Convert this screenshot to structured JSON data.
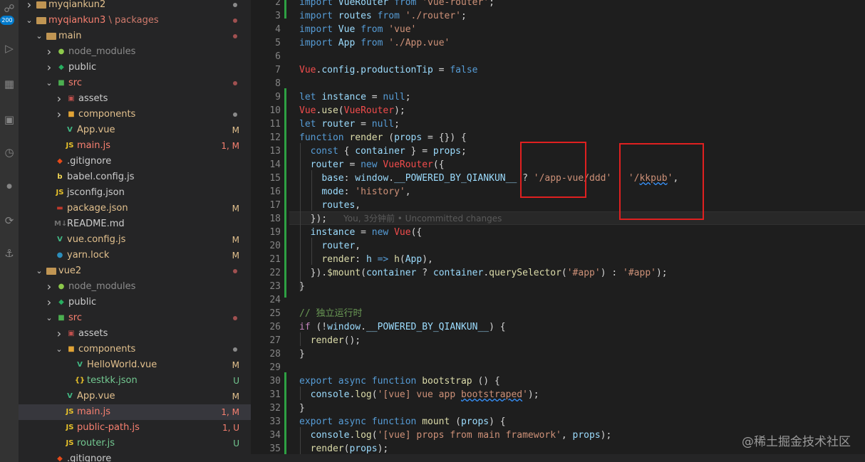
{
  "activity_bar": {
    "badge": "200",
    "icons": [
      "source-control-icon",
      "run-debug-icon",
      "extensions-icon",
      "remote-explorer-icon",
      "timeline-icon",
      "json-icon",
      "live-share-icon",
      "docker-icon"
    ]
  },
  "colors": {
    "keyword": "#569cd6",
    "control": "#c586c0",
    "string": "#ce9178",
    "variable": "#9cdcfe",
    "function": "#dcdcaa",
    "class": "#4ec9b0",
    "plain": "#d4d4d4",
    "comment": "#6a9955",
    "error_red": "#f14c4c",
    "modified": "#e2c08d",
    "untracked": "#73c991",
    "conflict": "#e2c08d"
  },
  "explorer": {
    "rows": [
      {
        "depth": 0,
        "type": "folder",
        "open": false,
        "name": "myqiankun2",
        "color": "#e2c08d",
        "status": "",
        "dot": "#8a8a8a"
      },
      {
        "depth": 0,
        "type": "folder",
        "open": true,
        "name": "myqiankun3",
        "suffix": "packages",
        "color": "#f88070",
        "status": "",
        "dot": "#a05050"
      },
      {
        "depth": 1,
        "type": "folder",
        "open": true,
        "name": "main",
        "color": "#e2c08d",
        "status": "",
        "dot": "#a05050"
      },
      {
        "depth": 2,
        "type": "folder",
        "open": false,
        "name": "node_modules",
        "icon": "node",
        "color": "#8c8c8c",
        "status": ""
      },
      {
        "depth": 2,
        "type": "folder",
        "open": false,
        "name": "public",
        "icon": "public",
        "color": "#cccccc",
        "status": ""
      },
      {
        "depth": 2,
        "type": "folder",
        "open": true,
        "name": "src",
        "icon": "src",
        "color": "#f88070",
        "status": "",
        "dot": "#a05050"
      },
      {
        "depth": 3,
        "type": "folder",
        "open": false,
        "name": "assets",
        "icon": "assets",
        "color": "#cccccc",
        "status": ""
      },
      {
        "depth": 3,
        "type": "folder",
        "open": false,
        "name": "components",
        "icon": "components",
        "color": "#e2c08d",
        "status": "",
        "dot": "#8a8a8a"
      },
      {
        "depth": 3,
        "type": "file",
        "name": "App.vue",
        "icon": "vue",
        "color": "#e2c08d",
        "status": "M"
      },
      {
        "depth": 3,
        "type": "file",
        "name": "main.js",
        "icon": "js",
        "color": "#f88070",
        "status": "1, M"
      },
      {
        "depth": 2,
        "type": "file",
        "name": ".gitignore",
        "icon": "git",
        "color": "#cccccc",
        "status": ""
      },
      {
        "depth": 2,
        "type": "file",
        "name": "babel.config.js",
        "icon": "babel",
        "color": "#cccccc",
        "status": ""
      },
      {
        "depth": 2,
        "type": "file",
        "name": "jsconfig.json",
        "icon": "js",
        "color": "#cccccc",
        "status": ""
      },
      {
        "depth": 2,
        "type": "file",
        "name": "package.json",
        "icon": "npm",
        "color": "#e2c08d",
        "status": "M"
      },
      {
        "depth": 2,
        "type": "file",
        "name": "README.md",
        "icon": "md",
        "color": "#cccccc",
        "status": ""
      },
      {
        "depth": 2,
        "type": "file",
        "name": "vue.config.js",
        "icon": "vue",
        "color": "#e2c08d",
        "status": "M"
      },
      {
        "depth": 2,
        "type": "file",
        "name": "yarn.lock",
        "icon": "yarn",
        "color": "#e2c08d",
        "status": "M"
      },
      {
        "depth": 1,
        "type": "folder",
        "open": true,
        "name": "vue2",
        "color": "#e2c08d",
        "status": "",
        "dot": "#a05050"
      },
      {
        "depth": 2,
        "type": "folder",
        "open": false,
        "name": "node_modules",
        "icon": "node",
        "color": "#8c8c8c",
        "status": ""
      },
      {
        "depth": 2,
        "type": "folder",
        "open": false,
        "name": "public",
        "icon": "public",
        "color": "#cccccc",
        "status": ""
      },
      {
        "depth": 2,
        "type": "folder",
        "open": true,
        "name": "src",
        "icon": "src",
        "color": "#f88070",
        "status": "",
        "dot": "#a05050"
      },
      {
        "depth": 3,
        "type": "folder",
        "open": false,
        "name": "assets",
        "icon": "assets",
        "color": "#cccccc",
        "status": ""
      },
      {
        "depth": 3,
        "type": "folder",
        "open": true,
        "name": "components",
        "icon": "components",
        "color": "#e2c08d",
        "status": "",
        "dot": "#8a8a8a"
      },
      {
        "depth": 4,
        "type": "file",
        "name": "HelloWorld.vue",
        "icon": "vue",
        "color": "#e2c08d",
        "status": "M"
      },
      {
        "depth": 4,
        "type": "file",
        "name": "testkk.json",
        "icon": "json",
        "color": "#73c991",
        "status": "U"
      },
      {
        "depth": 3,
        "type": "file",
        "name": "App.vue",
        "icon": "vue",
        "color": "#e2c08d",
        "status": "M"
      },
      {
        "depth": 3,
        "type": "file",
        "name": "main.js",
        "icon": "js",
        "color": "#f88070",
        "status": "1, M",
        "selected": true
      },
      {
        "depth": 3,
        "type": "file",
        "name": "public-path.js",
        "icon": "js",
        "color": "#f88070",
        "status": "1, U"
      },
      {
        "depth": 3,
        "type": "file",
        "name": "router.js",
        "icon": "js",
        "color": "#73c991",
        "status": "U"
      },
      {
        "depth": 2,
        "type": "file",
        "name": ".gitignore",
        "icon": "git",
        "color": "#cccccc",
        "status": ""
      }
    ]
  },
  "editor": {
    "lines": [
      {
        "n": "2",
        "t": [
          [
            "kw",
            "import "
          ],
          [
            "var",
            "VueRouter"
          ],
          [
            "kw",
            " from "
          ],
          [
            "str",
            "'vue-router'"
          ],
          [
            "pl",
            ";"
          ]
        ]
      },
      {
        "n": "3",
        "t": [
          [
            "kw",
            "import "
          ],
          [
            "var",
            "routes"
          ],
          [
            "kw",
            " from "
          ],
          [
            "str",
            "'./router'"
          ],
          [
            "pl",
            ";"
          ]
        ]
      },
      {
        "n": "4",
        "t": [
          [
            "kw",
            "import "
          ],
          [
            "var",
            "Vue"
          ],
          [
            "kw",
            " from "
          ],
          [
            "str",
            "'vue'"
          ]
        ]
      },
      {
        "n": "5",
        "t": [
          [
            "kw",
            "import "
          ],
          [
            "var",
            "App"
          ],
          [
            "kw",
            " from "
          ],
          [
            "str",
            "'./App.vue'"
          ]
        ]
      },
      {
        "n": "6",
        "t": []
      },
      {
        "n": "7",
        "t": [
          [
            "err",
            "Vue"
          ],
          [
            "pl",
            "."
          ],
          [
            "var",
            "config"
          ],
          [
            "pl",
            "."
          ],
          [
            "var",
            "productionTip"
          ],
          [
            "pl",
            " = "
          ],
          [
            "kw",
            "false"
          ]
        ]
      },
      {
        "n": "8",
        "t": []
      },
      {
        "n": "9",
        "t": [
          [
            "kw",
            "let "
          ],
          [
            "var",
            "instance"
          ],
          [
            "pl",
            " = "
          ],
          [
            "kw",
            "null"
          ],
          [
            "pl",
            ";"
          ]
        ]
      },
      {
        "n": "10",
        "t": [
          [
            "err",
            "Vue"
          ],
          [
            "pl",
            "."
          ],
          [
            "fn",
            "use"
          ],
          [
            "pl",
            "("
          ],
          [
            "err",
            "VueRouter"
          ],
          [
            "pl",
            ");"
          ]
        ]
      },
      {
        "n": "11",
        "t": [
          [
            "kw",
            "let "
          ],
          [
            "var",
            "router"
          ],
          [
            "pl",
            " = "
          ],
          [
            "kw",
            "null"
          ],
          [
            "pl",
            ";"
          ]
        ]
      },
      {
        "n": "12",
        "t": [
          [
            "kw",
            "function "
          ],
          [
            "fn",
            "render"
          ],
          [
            "pl",
            " ("
          ],
          [
            "var",
            "props"
          ],
          [
            "pl",
            " = {}) {"
          ]
        ]
      },
      {
        "n": "13",
        "t": [
          [
            "pl",
            "  "
          ],
          [
            "kw",
            "const "
          ],
          [
            "pl",
            "{ "
          ],
          [
            "var",
            "container"
          ],
          [
            "pl",
            " } = "
          ],
          [
            "var",
            "props"
          ],
          [
            "pl",
            ";"
          ]
        ]
      },
      {
        "n": "14",
        "t": [
          [
            "pl",
            "  "
          ],
          [
            "var",
            "router"
          ],
          [
            "pl",
            " = "
          ],
          [
            "kw",
            "new "
          ],
          [
            "err",
            "VueRouter"
          ],
          [
            "pl",
            "({"
          ]
        ]
      },
      {
        "n": "15",
        "t": [
          [
            "pl",
            "    "
          ],
          [
            "var",
            "base"
          ],
          [
            "pl",
            ": "
          ],
          [
            "var",
            "window"
          ],
          [
            "pl",
            "."
          ],
          [
            "var",
            "__POWERED_BY_QIANKUN__"
          ],
          [
            "pl",
            " ? "
          ],
          [
            "str",
            "'/app-vue/ddd'"
          ],
          [
            "pl",
            " : "
          ],
          [
            "str",
            "'/"
          ],
          [
            "strsq",
            "kkpub"
          ],
          [
            "str",
            "'"
          ],
          [
            "pl",
            ","
          ]
        ]
      },
      {
        "n": "16",
        "t": [
          [
            "pl",
            "    "
          ],
          [
            "var",
            "mode"
          ],
          [
            "pl",
            ": "
          ],
          [
            "str",
            "'history'"
          ],
          [
            "pl",
            ","
          ]
        ]
      },
      {
        "n": "17",
        "t": [
          [
            "pl",
            "    "
          ],
          [
            "var",
            "routes"
          ],
          [
            "pl",
            ","
          ]
        ]
      },
      {
        "n": "18",
        "t": [
          [
            "pl",
            "  });"
          ],
          [
            "cm",
            "      You, 3分钟前 • Uncommitted changes"
          ]
        ]
      },
      {
        "n": "19",
        "t": [
          [
            "pl",
            "  "
          ],
          [
            "var",
            "instance"
          ],
          [
            "pl",
            " = "
          ],
          [
            "kw",
            "new "
          ],
          [
            "err",
            "Vue"
          ],
          [
            "pl",
            "({"
          ]
        ]
      },
      {
        "n": "20",
        "t": [
          [
            "pl",
            "    "
          ],
          [
            "var",
            "router"
          ],
          [
            "pl",
            ","
          ]
        ]
      },
      {
        "n": "21",
        "t": [
          [
            "pl",
            "    "
          ],
          [
            "fn",
            "render"
          ],
          [
            "pl",
            ": "
          ],
          [
            "var",
            "h"
          ],
          [
            "kw",
            " => "
          ],
          [
            "fn",
            "h"
          ],
          [
            "pl",
            "("
          ],
          [
            "var",
            "App"
          ],
          [
            "pl",
            "),"
          ]
        ]
      },
      {
        "n": "22",
        "t": [
          [
            "pl",
            "  })."
          ],
          [
            "fn",
            "$mount"
          ],
          [
            "pl",
            "("
          ],
          [
            "var",
            "container"
          ],
          [
            "pl",
            " ? "
          ],
          [
            "var",
            "container"
          ],
          [
            "pl",
            "."
          ],
          [
            "fn",
            "querySelector"
          ],
          [
            "pl",
            "("
          ],
          [
            "str",
            "'#app'"
          ],
          [
            "pl",
            ") : "
          ],
          [
            "str",
            "'#app'"
          ],
          [
            "pl",
            ");"
          ]
        ]
      },
      {
        "n": "23",
        "t": [
          [
            "pl",
            "}"
          ]
        ]
      },
      {
        "n": "24",
        "t": []
      },
      {
        "n": "25",
        "t": [
          [
            "cmg",
            "// 独立运行时"
          ]
        ]
      },
      {
        "n": "26",
        "t": [
          [
            "ctl",
            "if "
          ],
          [
            "pl",
            "(!"
          ],
          [
            "var",
            "window"
          ],
          [
            "pl",
            "."
          ],
          [
            "var",
            "__POWERED_BY_QIANKUN__"
          ],
          [
            "pl",
            ") {"
          ]
        ]
      },
      {
        "n": "27",
        "t": [
          [
            "pl",
            "  "
          ],
          [
            "fn",
            "render"
          ],
          [
            "pl",
            "();"
          ]
        ]
      },
      {
        "n": "28",
        "t": [
          [
            "pl",
            "}"
          ]
        ]
      },
      {
        "n": "29",
        "t": []
      },
      {
        "n": "30",
        "t": [
          [
            "kw",
            "export async function "
          ],
          [
            "fn",
            "bootstrap"
          ],
          [
            "pl",
            " () {"
          ]
        ]
      },
      {
        "n": "31",
        "t": [
          [
            "pl",
            "  "
          ],
          [
            "var",
            "console"
          ],
          [
            "pl",
            "."
          ],
          [
            "fn",
            "log"
          ],
          [
            "pl",
            "("
          ],
          [
            "str",
            "'[vue] vue app "
          ],
          [
            "strsq",
            "bootstraped"
          ],
          [
            "str",
            "'"
          ],
          [
            "pl",
            ");"
          ]
        ]
      },
      {
        "n": "32",
        "t": [
          [
            "pl",
            "}"
          ]
        ]
      },
      {
        "n": "33",
        "t": [
          [
            "kw",
            "export async function "
          ],
          [
            "fn",
            "mount"
          ],
          [
            "pl",
            " ("
          ],
          [
            "var",
            "props"
          ],
          [
            "pl",
            ") {"
          ]
        ]
      },
      {
        "n": "34",
        "t": [
          [
            "pl",
            "  "
          ],
          [
            "var",
            "console"
          ],
          [
            "pl",
            "."
          ],
          [
            "fn",
            "log"
          ],
          [
            "pl",
            "("
          ],
          [
            "str",
            "'[vue] props from main framework'"
          ],
          [
            "pl",
            ", "
          ],
          [
            "var",
            "props"
          ],
          [
            "pl",
            ");"
          ]
        ]
      },
      {
        "n": "35",
        "t": [
          [
            "pl",
            "  "
          ],
          [
            "fn",
            "render"
          ],
          [
            "pl",
            "("
          ],
          [
            "var",
            "props"
          ],
          [
            "pl",
            ");"
          ]
        ]
      }
    ]
  },
  "watermark": "@稀土掘金技术社区"
}
